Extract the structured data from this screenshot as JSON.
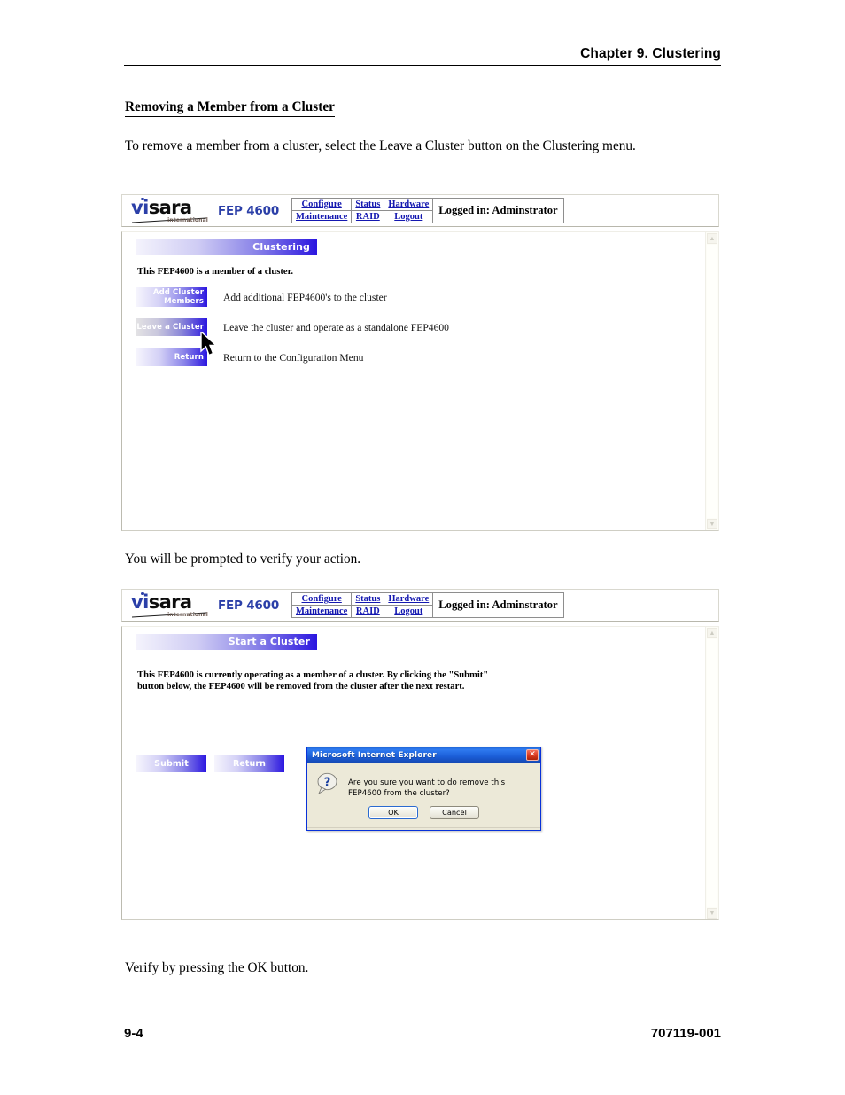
{
  "page": {
    "chapter_header": "Chapter 9. Clustering",
    "section_heading": "Removing a Member from a Cluster",
    "intro_paragraph": "To remove a member from a cluster, select the Leave a Cluster button on the Clustering menu.",
    "prompt_paragraph": "You will be prompted to verify your action.",
    "verify_paragraph": "Verify by pressing the OK button.",
    "footer_left": "9-4",
    "footer_right": "707119-001"
  },
  "app_header": {
    "logo_vi": "vi",
    "logo_sara": "sara",
    "logo_sub": "international",
    "model": "FEP 4600",
    "nav": {
      "row1": [
        "Configure",
        "Status",
        "Hardware"
      ],
      "row2": [
        "Maintenance",
        "RAID",
        "Logout"
      ]
    },
    "login_status": "Logged in: Adminstrator"
  },
  "screenshot_one": {
    "banner": "Clustering",
    "status_text": "This FEP4600 is a member of a cluster.",
    "menu_items": [
      {
        "label_line1": "Add Cluster",
        "label_line2": "Members",
        "description": "Add additional FEP4600's to the cluster"
      },
      {
        "label_line1": "Leave a Cluster",
        "label_line2": "",
        "description": "Leave the cluster and operate as a standalone FEP4600"
      },
      {
        "label_line1": "Return",
        "label_line2": "",
        "description": "Return to the Configuration Menu"
      }
    ]
  },
  "screenshot_two": {
    "banner": "Start a Cluster",
    "status_line1": "This FEP4600 is currently operating as a member of a cluster. By clicking the \"Submit\"",
    "status_line2": "button below, the FEP4600 will be removed from the cluster after the next restart.",
    "submit_label": "Submit",
    "return_label": "Return"
  },
  "dialog": {
    "title": "Microsoft Internet Explorer",
    "close_label": "✕",
    "message": "Are you sure you want to do remove this FEP4600 from the cluster?",
    "ok_label": "OK",
    "cancel_label": "Cancel"
  },
  "colors": {
    "link_blue": "#1418b0",
    "logo_blue": "#2b3fa8",
    "button_gradient_end": "#2b16e0",
    "dialog_titlebar": "#1b5ed8",
    "close_red": "#dd3c22"
  }
}
